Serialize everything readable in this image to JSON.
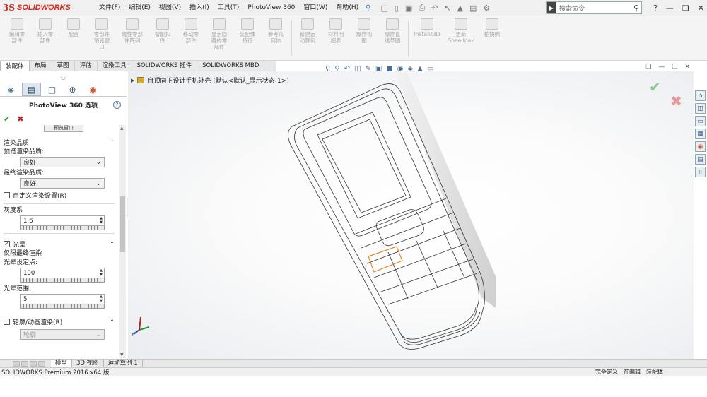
{
  "app": {
    "logo_ds": "3S",
    "logo_name": "SOLIDWORKS"
  },
  "menu": [
    "文件(F)",
    "编辑(E)",
    "视图(V)",
    "插入(I)",
    "工具(T)",
    "PhotoView 360",
    "窗口(W)",
    "帮助(H)"
  ],
  "search": {
    "placeholder": "搜索命令"
  },
  "commands": [
    {
      "label": "编辑零\n部件"
    },
    {
      "label": "插入零\n部件"
    },
    {
      "label": "配合"
    },
    {
      "label": "零部件\n预览窗\n口"
    },
    {
      "label": "线性零部\n件阵列"
    },
    {
      "label": "智能扣\n件"
    },
    {
      "label": "移动零\n部件"
    },
    {
      "label": "显示隐\n藏的零\n部件"
    },
    {
      "label": "装配体\n特征"
    },
    {
      "label": "参考几\n何体"
    },
    {
      "label": "新建运\n动算例"
    },
    {
      "label": "材料明\n细表"
    },
    {
      "label": "爆炸视\n图"
    },
    {
      "label": "爆炸直\n线草图"
    },
    {
      "label": "Instant3D"
    },
    {
      "label": "更新\nSpeedpak"
    },
    {
      "label": "拍快照"
    }
  ],
  "tabs": [
    "装配体",
    "布局",
    "草图",
    "评估",
    "渲染工具",
    "SOLIDWORKS 插件",
    "SOLIDWORKS MBD"
  ],
  "panel": {
    "title": "PhotoView 360 选项",
    "cut_button": "预览窗口",
    "render_quality": {
      "header": "渲染品质",
      "preview_label": "预览渲染品质:",
      "preview_value": "良好",
      "final_label": "最终渲染品质:",
      "final_value": "良好",
      "custom_label": "自定义渲染设置(R)",
      "gamma_label": "灰度系",
      "gamma_value": "1.6"
    },
    "bloom": {
      "header": "光晕",
      "final_only": "仅限最终渲染",
      "setpoint_label": "光晕设定点:",
      "setpoint_value": "100",
      "extent_label": "光晕范围:",
      "extent_value": "5"
    },
    "contour": {
      "header": "轮廓/动画渲染(R)",
      "value": "轮廓"
    }
  },
  "viewport": {
    "tree_item": "自顶向下设计手机外壳  (默认<默认_显示状态-1>)"
  },
  "bottom_tabs": [
    "模型",
    "3D 视图",
    "运动算例 1"
  ],
  "status": {
    "left": "SOLIDWORKS Premium 2016 x64 版",
    "right": [
      "完全定义",
      "在编辑",
      "装配体"
    ]
  }
}
